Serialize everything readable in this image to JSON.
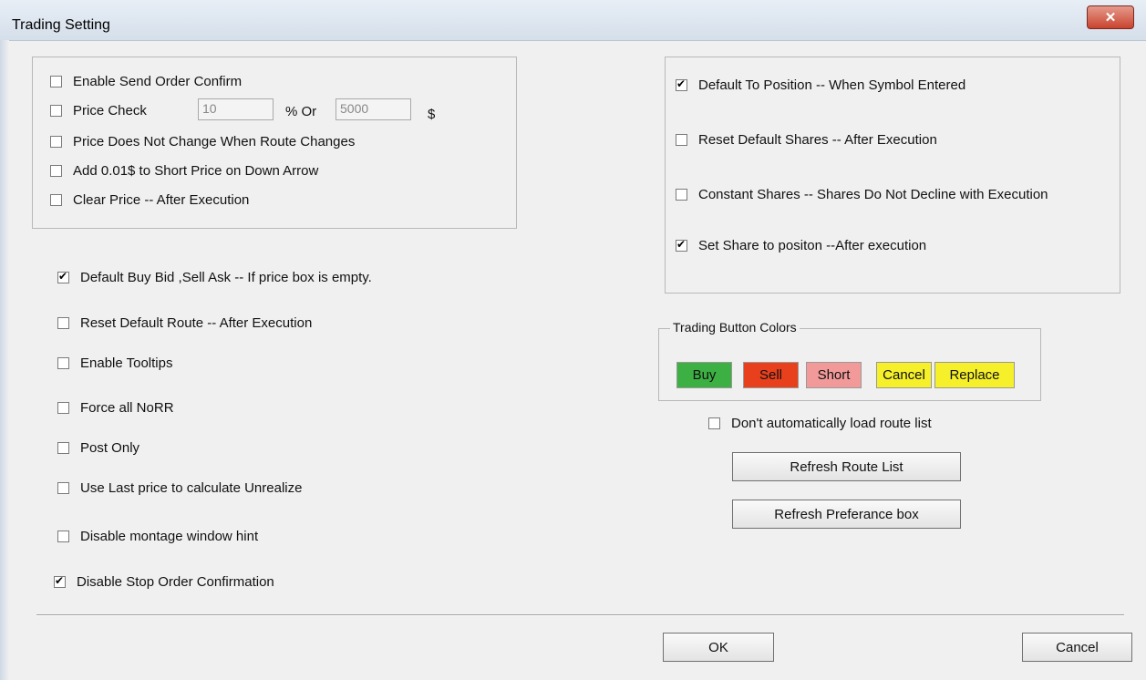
{
  "window": {
    "title": "Trading Setting",
    "close_label": "✕"
  },
  "price_group": {
    "enable_send_order_confirm": "Enable Send Order Confirm",
    "price_check": "Price Check",
    "price_check_percent_value": "10",
    "percent_or_label": "% Or",
    "price_check_dollar_value": "5000",
    "dollar_label": "$",
    "price_no_change": "Price Does Not Change When Route Changes",
    "add_short_price": "Add 0.01$ to Short Price on Down Arrow",
    "clear_price": "Clear Price -- After Execution"
  },
  "left_options": {
    "default_buy_bid": "Default Buy Bid ,Sell Ask -- If price box is empty.",
    "reset_default_route": "Reset Default Route -- After Execution",
    "enable_tooltips": "Enable Tooltips",
    "force_all_norr": "Force all NoRR",
    "post_only": "Post Only",
    "use_last_price": "Use Last price to calculate Unrealize",
    "disable_montage_hint": "Disable montage window hint",
    "disable_stop_confirm": "Disable Stop Order Confirmation"
  },
  "shares_group": {
    "default_to_position": "Default To Position -- When Symbol Entered",
    "reset_default_shares": "Reset Default Shares -- After Execution",
    "constant_shares": "Constant Shares -- Shares Do Not Decline with Execution",
    "set_share_to_position": "Set Share to positon --After execution"
  },
  "trading_colors": {
    "title": "Trading Button Colors",
    "buy": "Buy",
    "sell": "Sell",
    "short": "Short",
    "cancel": "Cancel",
    "replace": "Replace",
    "buy_color": "#3cb043",
    "sell_color": "#e8401c",
    "short_color": "#f29a9a",
    "cancel_color": "#f5f02a",
    "replace_color": "#f5f02a"
  },
  "routes": {
    "dont_auto_load": "Don't automatically load route list",
    "refresh_route_list": "Refresh Route List",
    "refresh_preference_box": "Refresh Preferance box"
  },
  "footer": {
    "ok": "OK",
    "cancel": "Cancel"
  }
}
